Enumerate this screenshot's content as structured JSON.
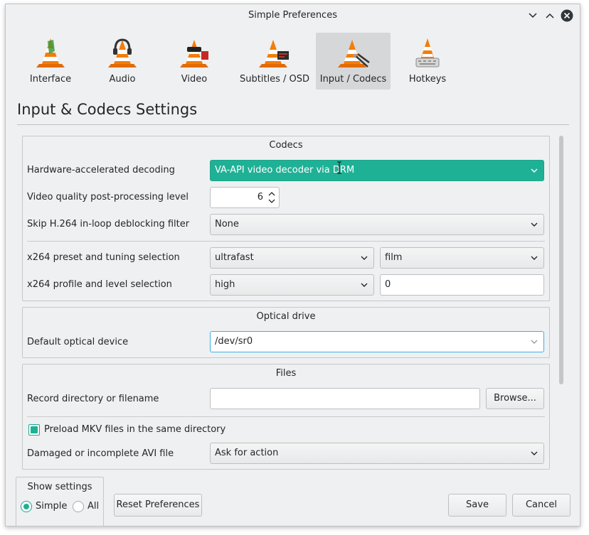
{
  "window": {
    "title": "Simple Preferences"
  },
  "toolbar": {
    "items": [
      {
        "label": "Interface",
        "icon": "vlc-cone-interface-icon"
      },
      {
        "label": "Audio",
        "icon": "vlc-cone-headphones-icon"
      },
      {
        "label": "Video",
        "icon": "vlc-cone-video-icon"
      },
      {
        "label": "Subtitles / OSD",
        "icon": "vlc-cone-subtitles-icon"
      },
      {
        "label": "Input / Codecs",
        "icon": "vlc-cone-codecs-icon",
        "active": true
      },
      {
        "label": "Hotkeys",
        "icon": "vlc-cone-hotkeys-icon"
      }
    ]
  },
  "page": {
    "title": "Input & Codecs Settings"
  },
  "codecs": {
    "title": "Codecs",
    "hw_label": "Hardware-accelerated decoding",
    "hw_value": "VA-API video decoder via DRM",
    "quality_label": "Video quality post-processing level",
    "quality_value": "6",
    "skip_label": "Skip H.264 in-loop deblocking filter",
    "skip_value": "None",
    "preset_label": "x264 preset and tuning selection",
    "preset_value": "ultrafast",
    "tune_value": "film",
    "profile_label": "x264 profile and level selection",
    "profile_value": "high",
    "level_value": "0"
  },
  "optical": {
    "title": "Optical drive",
    "device_label": "Default optical device",
    "device_value": "/dev/sr0"
  },
  "files": {
    "title": "Files",
    "record_label": "Record directory or filename",
    "record_value": "",
    "browse_label": "Browse...",
    "preload_label": "Preload MKV files in the same directory",
    "preload_checked": true,
    "avi_label": "Damaged or incomplete AVI file",
    "avi_value": "Ask for action"
  },
  "footer": {
    "show_settings": "Show settings",
    "simple_label": "Simple",
    "all_label": "All",
    "selected": "Simple",
    "reset_label": "Reset Preferences",
    "save_label": "Save",
    "cancel_label": "Cancel"
  },
  "colors": {
    "accent": "#1fb196",
    "window_bg": "#eff0f1",
    "text": "#232629"
  }
}
